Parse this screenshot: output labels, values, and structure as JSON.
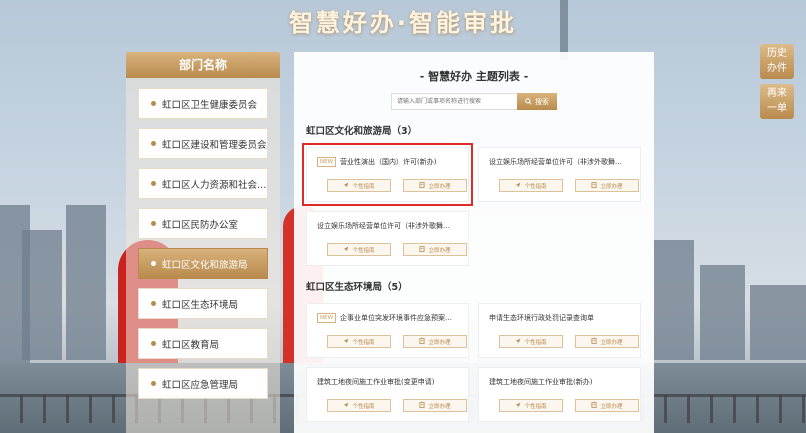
{
  "page_title": "智慧好办·智能审批",
  "department_panel": {
    "header": "部门名称",
    "items": [
      "虹口区卫生健康委员会",
      "虹口区建设和管理委员会",
      "虹口区人力资源和社会…",
      "虹口区民防办公室",
      "虹口区文化和旅游局",
      "虹口区生态环境局",
      "虹口区教育局",
      "虹口区应急管理局"
    ],
    "active_index": 4
  },
  "main_panel": {
    "title": "- 智慧好办 主题列表 -",
    "search": {
      "placeholder": "请输入部门或事项名称进行搜索",
      "button_label": "搜索"
    },
    "sections": [
      {
        "title": "虹口区文化和旅游局（3）",
        "cards": [
          {
            "name": "营业性演出（国内）许可(新办)",
            "is_new": true,
            "highlighted": true
          },
          {
            "name": "设立娱乐场所经营单位许可（非涉外歌舞…",
            "is_new": false,
            "highlighted": false
          },
          {
            "name": "设立娱乐场所经营单位许可（非涉外歌舞…",
            "is_new": false,
            "highlighted": false
          }
        ]
      },
      {
        "title": "虹口区生态环境局（5）",
        "cards": [
          {
            "name": "企事业单位突发环境事件应急预案…",
            "is_new": true,
            "highlighted": false
          },
          {
            "name": "申请生态环境行政处罚记录查询单",
            "is_new": false,
            "highlighted": false
          },
          {
            "name": "建筑工地夜间施工作业审批(变更申请)",
            "is_new": false,
            "highlighted": false
          },
          {
            "name": "建筑工地夜间施工作业审批(新办)",
            "is_new": false,
            "highlighted": false
          }
        ]
      }
    ],
    "new_tag": "NEW",
    "guide_label": "个性指南",
    "apply_label": "立即办理"
  },
  "side_buttons": [
    {
      "line1": "历史",
      "line2": "办件"
    },
    {
      "line1": "再来",
      "line2": "一单"
    }
  ],
  "colors": {
    "accent": "#b98a4d",
    "highlight_box": "#e02a2a"
  }
}
